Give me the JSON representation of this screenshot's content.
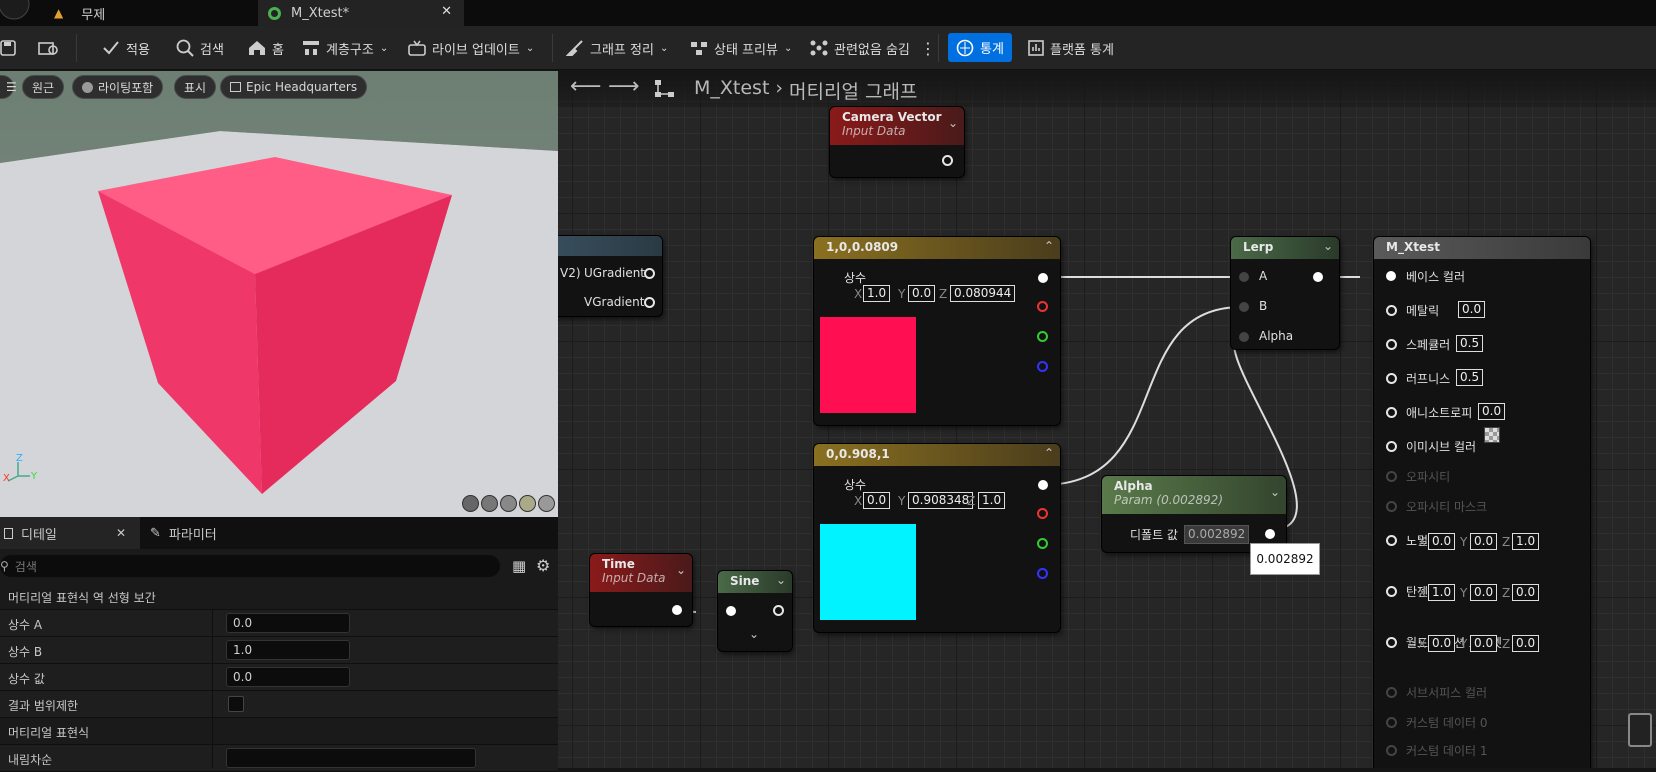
{
  "tabs": [
    {
      "label": "무제"
    },
    {
      "label": "M_Xtest*"
    }
  ],
  "toolbar": {
    "apply": "적용",
    "search": "검색",
    "home": "홈",
    "hierarchy": "계층구조",
    "live_update": "라이브 업데이트",
    "clean_graph": "그래프 정리",
    "state_preview": "상태 프리뷰",
    "hide_unrelated": "관련없음 숨김",
    "stats": "통계",
    "platform_stats": "플랫폼 통계"
  },
  "viewport": {
    "perspective": "원근",
    "lit": "라이팅포함",
    "show": "표시",
    "preview": "Epic Headquarters"
  },
  "details": {
    "tab_details": "디테일",
    "tab_params": "파라미터",
    "search_placeholder": "검색",
    "section1": "머티리얼 표현식 역 선형 보간",
    "rows": [
      {
        "label": "상수 A",
        "value": "0.0"
      },
      {
        "label": "상수 B",
        "value": "1.0"
      },
      {
        "label": "상수 값",
        "value": "0.0"
      },
      {
        "label": "결과 범위제한",
        "value": ""
      }
    ],
    "section2": "머티리얼 표현식",
    "last_label": "내림차순"
  },
  "breadcrumb": {
    "asset": "M_Xtest",
    "graph": "머티리얼 그래프"
  },
  "nodes": {
    "camera": {
      "title": "Camera Vector",
      "sub": "Input Data"
    },
    "grad": {
      "partial": "V2)",
      "u": "UGradient",
      "v": "VGradient"
    },
    "c1": {
      "title": "1,0,0.0809",
      "label": "상수",
      "x": "1.0",
      "y": "0.0",
      "z": "0.080944",
      "color": "#ff0e51"
    },
    "c2": {
      "title": "0,0.908,1",
      "label": "상수",
      "x": "0.0",
      "y": "0.908348",
      "z": "1.0",
      "color": "#00f3fe"
    },
    "time": {
      "title": "Time",
      "sub": "Input Data"
    },
    "sine": {
      "title": "Sine"
    },
    "lerp": {
      "title": "Lerp",
      "a": "A",
      "b": "B",
      "alpha": "Alpha"
    },
    "alpha": {
      "title": "Alpha",
      "sub": "Param (0.002892)",
      "default_label": "디폴트 값",
      "default_value": "0.002892",
      "tooltip": "0.002892"
    },
    "result": {
      "title": "M_Xtest",
      "pins": [
        {
          "label": "베이스 컬러",
          "value": ""
        },
        {
          "label": "메탈릭",
          "value": "0.0"
        },
        {
          "label": "스페큘러",
          "value": "0.5"
        },
        {
          "label": "러프니스",
          "value": "0.5"
        },
        {
          "label": "애니소트로피",
          "value": "0.0"
        },
        {
          "label": "이미시브 컬러",
          "value": ""
        },
        {
          "label": "오파시티",
          "value": ""
        },
        {
          "label": "오파시티 마스크",
          "value": ""
        },
        {
          "label": "노멀",
          "value": ""
        },
        {
          "label": "탄젠트",
          "value": ""
        },
        {
          "label": "월드 포지션 오프셋",
          "value": ""
        },
        {
          "label": "서브서피스 컬러",
          "value": ""
        },
        {
          "label": "커스텀 데이터 0",
          "value": ""
        },
        {
          "label": "커스텀 데이터 1",
          "value": ""
        }
      ],
      "normal": {
        "x": "0.0",
        "y": "0.0",
        "z": "1.0"
      },
      "tangent": {
        "x": "1.0",
        "y": "0.0",
        "z": "0.0"
      },
      "wpo": {
        "x": "0.0",
        "y": "0.0",
        "z": "0.0"
      }
    }
  }
}
